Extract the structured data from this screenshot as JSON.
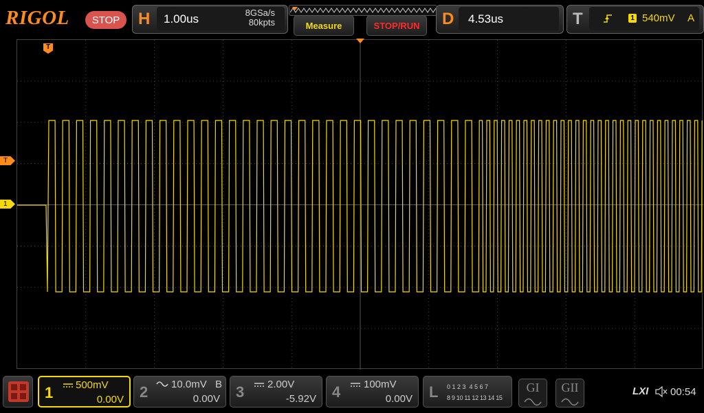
{
  "brand": "RIGOL",
  "run_state": "STOP",
  "horizontal": {
    "letter": "H",
    "timebase": "1.00us",
    "sample_rate": "8GSa/s",
    "memory_depth": "80kpts"
  },
  "buttons": {
    "measure": "Measure",
    "stop_run": "STOP/RUN"
  },
  "delay": {
    "letter": "D",
    "value": "4.53us"
  },
  "trigger": {
    "letter": "T",
    "source": "1",
    "level": "540mV",
    "mode": "A"
  },
  "markers": {
    "trigger_level": "T",
    "ch1_ground": "1",
    "trigger_pos": "T"
  },
  "channels": [
    {
      "num": "1",
      "coupling_icon": "dc-coupling-icon",
      "scale": "500mV",
      "offset": "0.00V",
      "color": "#f5d90a",
      "active": true
    },
    {
      "num": "2",
      "coupling_icon": "ac-coupling-icon",
      "scale": "10.0mV",
      "bw": "B",
      "offset": "0.00V",
      "color": "#888888",
      "active": false
    },
    {
      "num": "3",
      "coupling_icon": "dc-coupling-icon",
      "scale": "2.00V",
      "offset": "-5.92V",
      "color": "#888888",
      "active": false
    },
    {
      "num": "4",
      "coupling_icon": "dc-coupling-icon",
      "scale": "100mV",
      "offset": "0.00V",
      "color": "#888888",
      "active": false
    }
  ],
  "logic": {
    "letter": "L",
    "row1": "0 1 2 3  4 5 6 7",
    "row2": "8 9 10 11 12 13 14 15"
  },
  "generators": {
    "g1": "GI",
    "g2": "GII"
  },
  "status": {
    "lxi": "LXI",
    "time": "00:54"
  },
  "colors": {
    "accent": "#ff8c1a",
    "ch1": "#f5d90a",
    "stop": "#d9534f",
    "measure_text": "#f5d90a",
    "stoprun_text": "#ff2a2a"
  }
}
